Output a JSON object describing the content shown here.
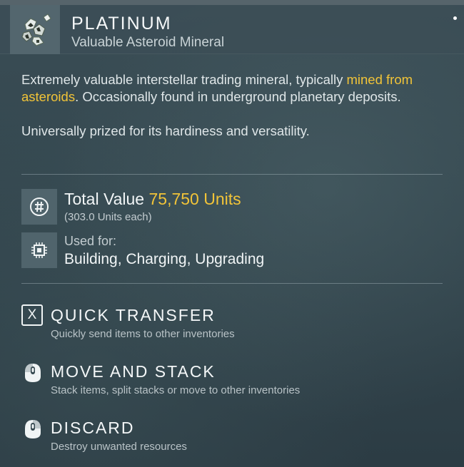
{
  "item": {
    "name": "PLATINUM",
    "category": "Valuable Asteroid Mineral",
    "icon": "platinum-ore-icon"
  },
  "description": {
    "p1_before": "Extremely valuable interstellar trading mineral, typically ",
    "p1_highlight": "mined from asteroids",
    "p1_after": ". Occasionally found in underground planetary deposits.",
    "p2": "Universally prized for its hardiness and versatility."
  },
  "value": {
    "label": "Total Value",
    "amount": "75,750 Units",
    "each": "(303.0 Units each)",
    "icon": "units-currency-icon"
  },
  "usage": {
    "label": "Used for:",
    "value": "Building, Charging, Upgrading",
    "icon": "chip-icon"
  },
  "actions": [
    {
      "title": "QUICK TRANSFER",
      "desc": "Quickly send items to other inventories",
      "icon": "x-key-icon",
      "key": "X"
    },
    {
      "title": "MOVE AND STACK",
      "desc": "Stack items, split stacks or move to other inventories",
      "icon": "mouse-left-icon"
    },
    {
      "title": "DISCARD",
      "desc": "Destroy unwanted resources",
      "icon": "mouse-right-icon"
    }
  ],
  "colors": {
    "highlight": "#f2c438",
    "panel": "#34474f"
  }
}
